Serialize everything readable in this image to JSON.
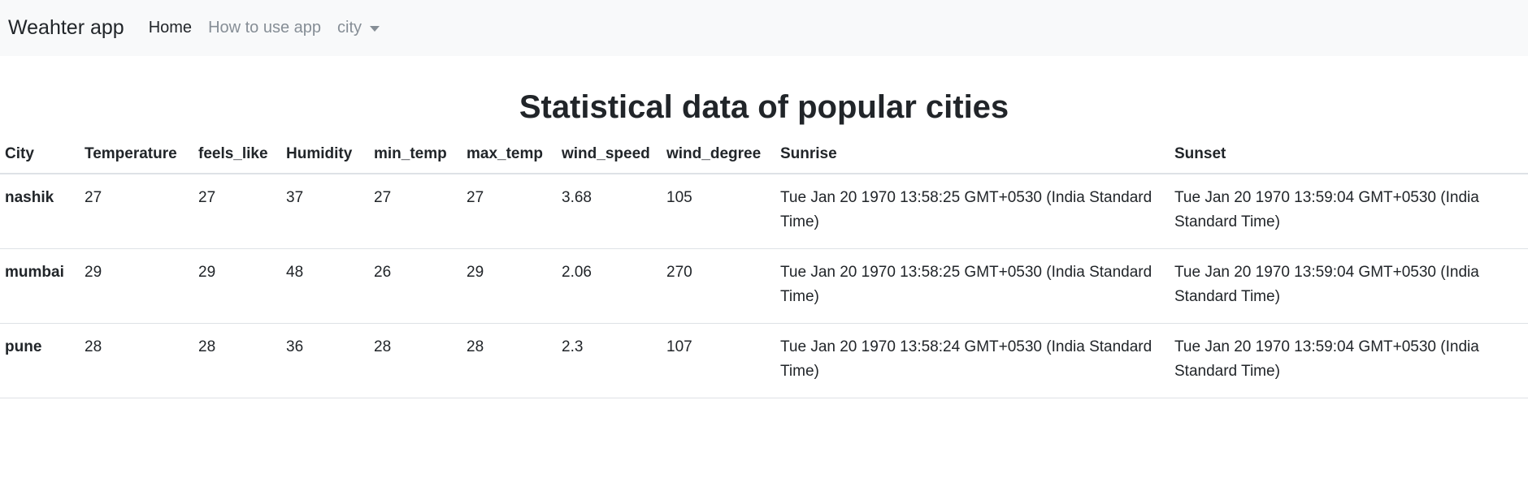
{
  "navbar": {
    "brand": "Weahter app",
    "items": [
      {
        "label": "Home"
      },
      {
        "label": "How to use app"
      },
      {
        "label": "city"
      }
    ]
  },
  "main": {
    "title": "Statistical data of popular cities",
    "table": {
      "headers": [
        "City",
        "Temperature",
        "feels_like",
        "Humidity",
        "min_temp",
        "max_temp",
        "wind_speed",
        "wind_degree",
        "Sunrise",
        "Sunset"
      ],
      "rows": [
        {
          "city": "nashik",
          "temperature": "27",
          "feels_like": "27",
          "humidity": "37",
          "min_temp": "27",
          "max_temp": "27",
          "wind_speed": "3.68",
          "wind_degree": "105",
          "sunrise": "Tue Jan 20 1970 13:58:25 GMT+0530 (India Standard Time)",
          "sunset": "Tue Jan 20 1970 13:59:04 GMT+0530 (India Standard Time)"
        },
        {
          "city": "mumbai",
          "temperature": "29",
          "feels_like": "29",
          "humidity": "48",
          "min_temp": "26",
          "max_temp": "29",
          "wind_speed": "2.06",
          "wind_degree": "270",
          "sunrise": "Tue Jan 20 1970 13:58:25 GMT+0530 (India Standard Time)",
          "sunset": "Tue Jan 20 1970 13:59:04 GMT+0530 (India Standard Time)"
        },
        {
          "city": "pune",
          "temperature": "28",
          "feels_like": "28",
          "humidity": "36",
          "min_temp": "28",
          "max_temp": "28",
          "wind_speed": "2.3",
          "wind_degree": "107",
          "sunrise": "Tue Jan 20 1970 13:58:24 GMT+0530 (India Standard Time)",
          "sunset": "Tue Jan 20 1970 13:59:04 GMT+0530 (India Standard Time)"
        }
      ]
    }
  }
}
